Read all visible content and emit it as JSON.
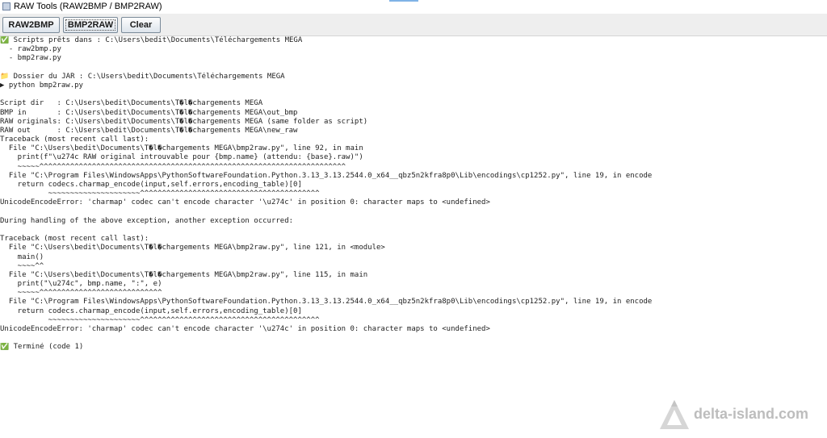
{
  "window": {
    "title": "RAW Tools (RAW2BMP / BMP2RAW)"
  },
  "toolbar": {
    "raw2bmp_label": "RAW2BMP",
    "bmp2raw_label": "BMP2RAW",
    "clear_label": "Clear"
  },
  "console": {
    "lines": [
      "✅ Scripts prêts dans : C:\\Users\\bedit\\Documents\\Téléchargements MEGA",
      "  - raw2bmp.py",
      "  - bmp2raw.py",
      "",
      "📁 Dossier du JAR : C:\\Users\\bedit\\Documents\\Téléchargements MEGA",
      "▶ python bmp2raw.py",
      "",
      "Script dir   : C:\\Users\\bedit\\Documents\\T�l�chargements MEGA",
      "BMP in       : C:\\Users\\bedit\\Documents\\T�l�chargements MEGA\\out_bmp",
      "RAW originals: C:\\Users\\bedit\\Documents\\T�l�chargements MEGA (same folder as script)",
      "RAW out      : C:\\Users\\bedit\\Documents\\T�l�chargements MEGA\\new_raw",
      "Traceback (most recent call last):",
      "  File \"C:\\Users\\bedit\\Documents\\T�l�chargements MEGA\\bmp2raw.py\", line 92, in main",
      "    print(f\"\\u274c RAW original introuvable pour {bmp.name} (attendu: {base}.raw)\")",
      "    ~~~~~^^^^^^^^^^^^^^^^^^^^^^^^^^^^^^^^^^^^^^^^^^^^^^^^^^^^^^^^^^^^^^^^^^^^^^",
      "  File \"C:\\Program Files\\WindowsApps\\PythonSoftwareFoundation.Python.3.13_3.13.2544.0_x64__qbz5n2kfra8p0\\Lib\\encodings\\cp1252.py\", line 19, in encode",
      "    return codecs.charmap_encode(input,self.errors,encoding_table)[0]",
      "           ~~~~~~~~~~~~~~~~~~~~~^^^^^^^^^^^^^^^^^^^^^^^^^^^^^^^^^^^^^^^^^",
      "UnicodeEncodeError: 'charmap' codec can't encode character '\\u274c' in position 0: character maps to <undefined>",
      "",
      "During handling of the above exception, another exception occurred:",
      "",
      "Traceback (most recent call last):",
      "  File \"C:\\Users\\bedit\\Documents\\T�l�chargements MEGA\\bmp2raw.py\", line 121, in <module>",
      "    main()",
      "    ~~~~^^",
      "  File \"C:\\Users\\bedit\\Documents\\T�l�chargements MEGA\\bmp2raw.py\", line 115, in main",
      "    print(\"\\u274c\", bmp.name, \":\", e)",
      "    ~~~~~^^^^^^^^^^^^^^^^^^^^^^^^^^^^",
      "  File \"C:\\Program Files\\WindowsApps\\PythonSoftwareFoundation.Python.3.13_3.13.2544.0_x64__qbz5n2kfra8p0\\Lib\\encodings\\cp1252.py\", line 19, in encode",
      "    return codecs.charmap_encode(input,self.errors,encoding_table)[0]",
      "           ~~~~~~~~~~~~~~~~~~~~~^^^^^^^^^^^^^^^^^^^^^^^^^^^^^^^^^^^^^^^^^",
      "UnicodeEncodeError: 'charmap' codec can't encode character '\\u274c' in position 0: character maps to <undefined>",
      "",
      "✅ Terminé (code 1)"
    ]
  },
  "watermark": {
    "text": "delta-island.com"
  },
  "colors": {
    "toolbar_bg": "#eeeeee",
    "watermark": "#bdbdbd",
    "console_text": "#1e1e1e"
  },
  "icons": {
    "app": "window-app-icon",
    "check": "check-icon",
    "folder": "folder-icon",
    "play": "play-icon"
  }
}
